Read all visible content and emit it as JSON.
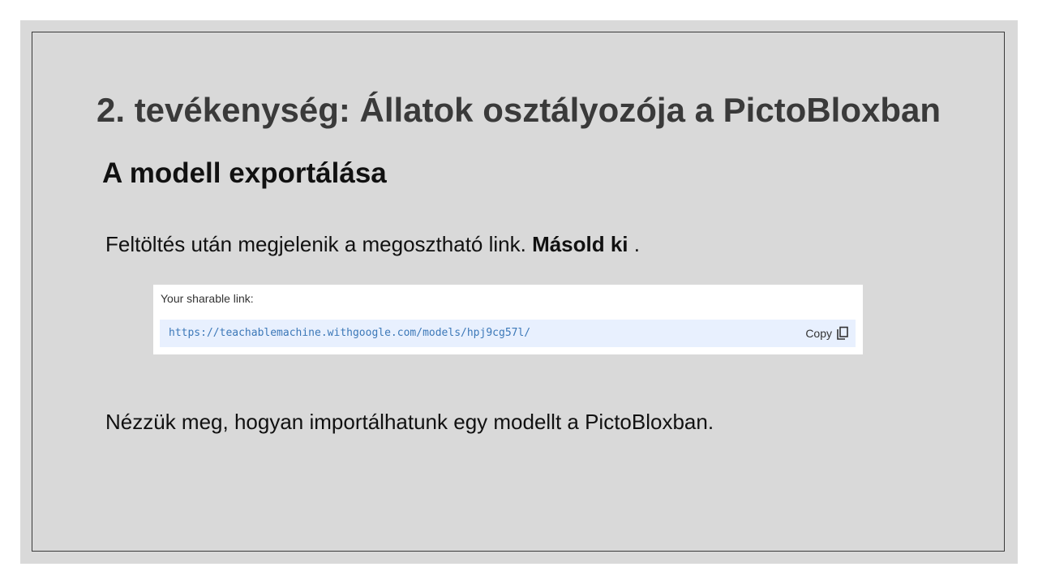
{
  "slide": {
    "title": "2. tevékenység: Állatok osztályozója a PictoBloxban",
    "subtitle": "A modell exportálása",
    "paragraph1": {
      "text": "Feltöltés után megjelenik a megosztható link. ",
      "bold": "Másold ki",
      "suffix": " ."
    },
    "paragraph2": "Nézzük meg, hogyan importálhatunk egy modellt a PictoBloxban."
  },
  "share_panel": {
    "label": "Your sharable link:",
    "url": "https://teachablemachine.withgoogle.com/models/hpj9cg57l/",
    "copy_label": "Copy",
    "copy_icon": "copy-icon"
  },
  "colors": {
    "slide_background": "#d9d9d9",
    "link_box_background": "#e8f0fe",
    "url_text": "#3c78b8"
  }
}
